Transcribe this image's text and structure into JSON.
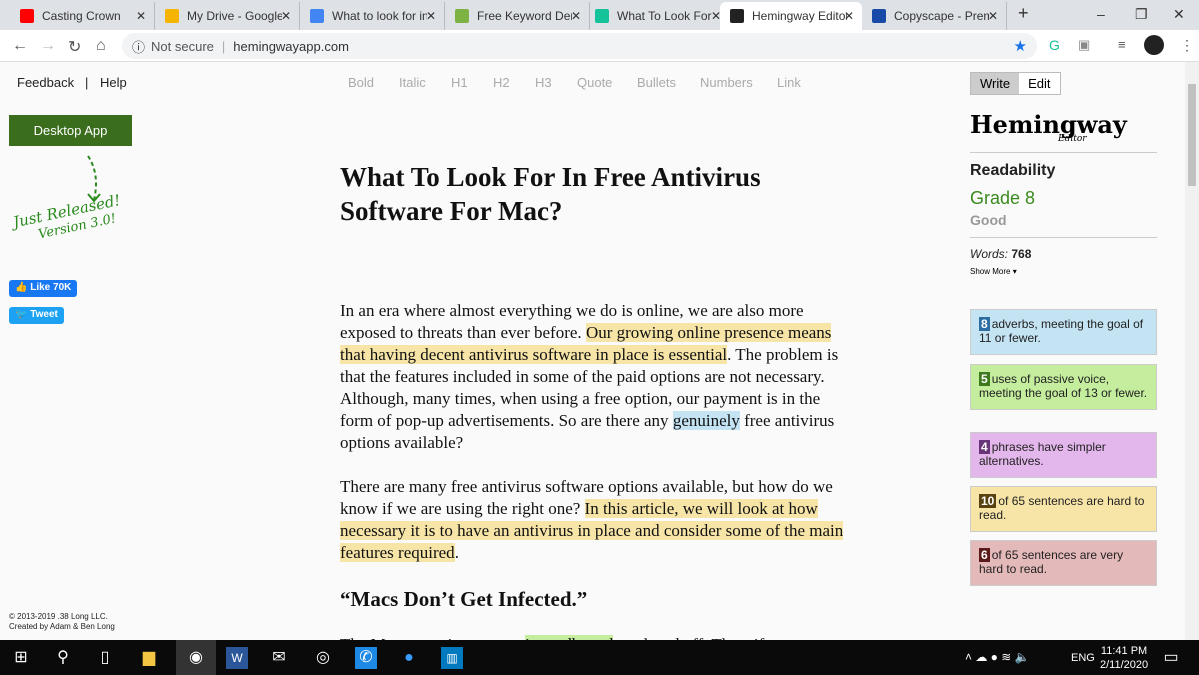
{
  "browser": {
    "tabs": [
      {
        "label": "Casting Crown",
        "icon": "youtube-icon",
        "color": "#ff0000"
      },
      {
        "label": "My Drive - Google",
        "icon": "drive-icon",
        "color": "#f4b400"
      },
      {
        "label": "What to look for in",
        "icon": "docs-icon",
        "color": "#4285f4"
      },
      {
        "label": "Free Keyword Den",
        "icon": "keyword-icon",
        "color": "#7cb342"
      },
      {
        "label": "What To Look For",
        "icon": "grammarly-icon",
        "color": "#15c39a"
      },
      {
        "label": "Hemingway Editor",
        "icon": "hemingway-icon",
        "color": "#222222"
      },
      {
        "label": "Copyscape - Prem",
        "icon": "copyscape-icon",
        "color": "#1a4aa8"
      }
    ],
    "security": "Not secure",
    "url": "hemingwayapp.com"
  },
  "header": {
    "feedback": "Feedback",
    "sep": "|",
    "help": "Help",
    "format": [
      "Bold",
      "Italic",
      "H1",
      "H2",
      "H3",
      "Quote",
      "Bullets",
      "Numbers",
      "Link"
    ]
  },
  "left": {
    "desktop_app": "Desktop App",
    "released": "Just Released!",
    "version": "Version 3.0!",
    "like": "Like 70K",
    "tweet": "Tweet",
    "copyright": "© 2013-2019 .38 Long LLC.",
    "created_by": "Created by",
    "authors": "Adam & Ben Long"
  },
  "editor": {
    "title": "What To Look For In Free Antivirus Software For Mac?",
    "paragraphs": [
      [
        {
          "t": "In an era where almost everything we do is online, we are also more exposed to threats than ever before. "
        },
        {
          "t": "Our growing online presence means that having decent antivirus software in place is essential",
          "c": "hard"
        },
        {
          "t": ". The problem is that the features included in some of the paid options are not necessary. Although, many times, when using a free option, our payment is in the form of pop-up advertisements. So are there any "
        },
        {
          "t": "genuinely",
          "c": "adverb"
        },
        {
          "t": " free antivirus options available?"
        }
      ],
      [
        {
          "t": "There are many free antivirus software options available, but how do we know if we are using the right one? "
        },
        {
          "t": "In this article, we will look at how necessary it is to have an antivirus in place and consider some of the main features required",
          "c": "hard"
        },
        {
          "t": "."
        }
      ]
    ],
    "subheading": "“Macs Don’t Get Infected.”",
    "last": [
      {
        "t": "The Mac operating system "
      },
      {
        "t": "is sandboxed",
        "c": "passive"
      },
      {
        "t": " or closed off. Thus, if"
      }
    ]
  },
  "sidebar": {
    "write": "Write",
    "edit": "Edit",
    "logo": "Hemingway",
    "logo_sub": "Editor",
    "readability": "Readability",
    "grade": "Grade 8",
    "grade_label": "Good",
    "words_label": "Words:",
    "words": "768",
    "show_more": "Show More",
    "stats": [
      {
        "n": "8",
        "text": "adverbs, meeting the goal of 11 or fewer.",
        "bg": "#c4e3f3",
        "nbg": "#2d6ea3"
      },
      {
        "n": "5",
        "text": "uses of passive voice, meeting the goal of 13 or fewer.",
        "bg": "#c4ed9d",
        "nbg": "#3d7a1e"
      },
      {
        "n": "4",
        "text": "phrases have simpler alternatives.",
        "bg": "#e3b7eb",
        "nbg": "#6a3578"
      },
      {
        "n": "10",
        "text": "of 65 sentences are hard to read.",
        "bg": "#f7e5a8",
        "nbg": "#5a4210"
      },
      {
        "n": "6",
        "text": "of 65 sentences are very hard to read.",
        "bg": "#e4b9b9",
        "nbg": "#5a1a1a"
      }
    ]
  },
  "taskbar": {
    "lang": "ENG",
    "time": "11:41 PM",
    "date": "2/11/2020"
  }
}
